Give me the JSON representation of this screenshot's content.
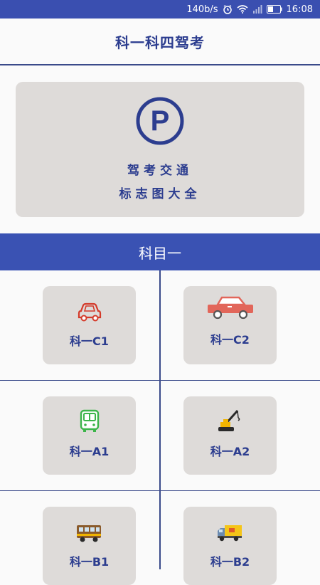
{
  "status_bar": {
    "speed": "140b/s",
    "time": "16:08"
  },
  "header": {
    "title": "科一科四驾考"
  },
  "banner": {
    "line1": "驾考交通",
    "line2": "标志图大全",
    "icon": "parking-sign-icon"
  },
  "section": {
    "title": "科目一"
  },
  "cards": [
    {
      "label": "科一C1",
      "icon": "small-car-icon"
    },
    {
      "label": "科一C2",
      "icon": "sedan-car-icon"
    },
    {
      "label": "科一A1",
      "icon": "bus-icon"
    },
    {
      "label": "科一A2",
      "icon": "crane-truck-icon"
    },
    {
      "label": "科一B1",
      "icon": "large-truck-icon"
    },
    {
      "label": "科一B2",
      "icon": "delivery-truck-icon"
    }
  ],
  "colors": {
    "accent": "#3a52b3",
    "text": "#2c3d8f",
    "card": "#dedbd9"
  }
}
